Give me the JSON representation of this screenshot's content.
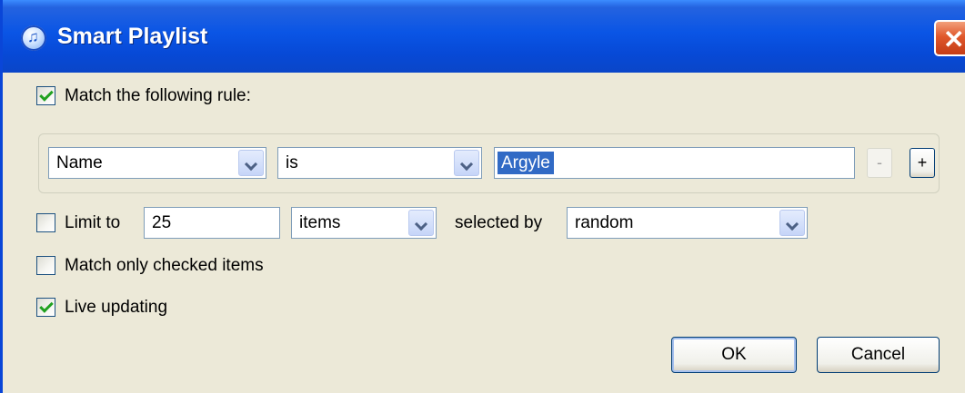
{
  "window": {
    "title": "Smart Playlist",
    "close_label": "✕"
  },
  "match_rule": {
    "checked": true,
    "label": "Match the following rule:"
  },
  "rule": {
    "field": "Name",
    "operator": "is",
    "value": "Argyle",
    "remove_label": "-",
    "add_label": "+"
  },
  "limit": {
    "checked": false,
    "label": "Limit to",
    "value": "25",
    "unit": "items",
    "selected_by_label": "selected by",
    "selected_by": "random"
  },
  "match_checked": {
    "checked": false,
    "label": "Match only checked items"
  },
  "live_updating": {
    "checked": true,
    "label": "Live updating"
  },
  "buttons": {
    "ok": "OK",
    "cancel": "Cancel"
  },
  "colors": {
    "titlebar": "#0a55e5",
    "dialog_bg": "#ece9d8",
    "selection": "#316ac5",
    "check": "#21a121"
  }
}
